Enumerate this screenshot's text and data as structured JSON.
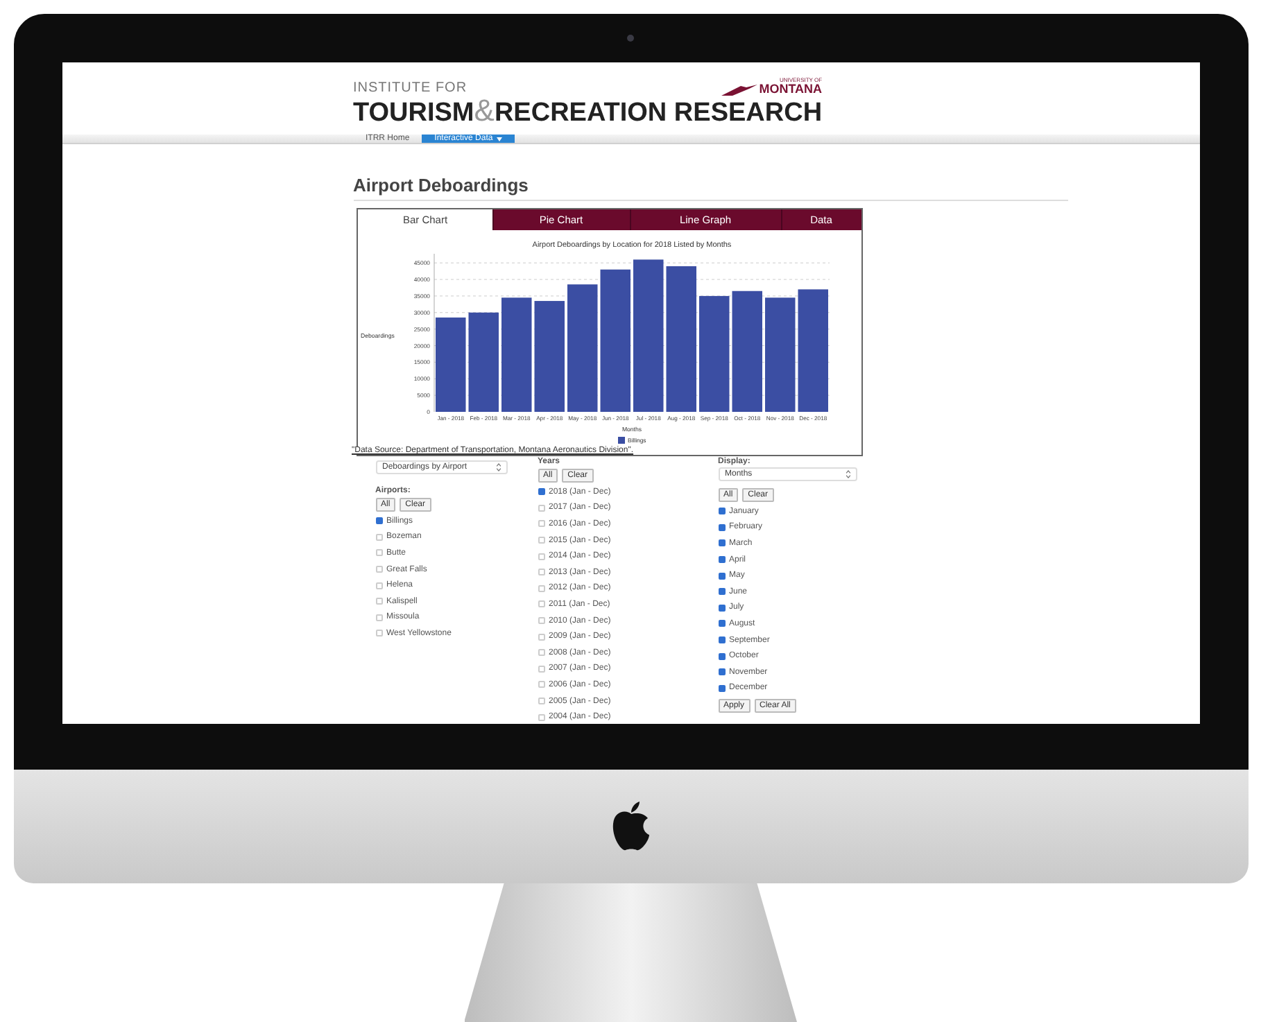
{
  "header": {
    "institute": "INSTITUTE FOR",
    "title_left": "TOURISM",
    "ampersand": "&",
    "title_right": "RECREATION RESEARCH",
    "university": "UNIVERSITY OF",
    "montana": "MONTANA"
  },
  "nav": [
    {
      "label": "ITRR Home",
      "selected": false,
      "dropdown": false
    },
    {
      "label": "Interactive Data",
      "selected": true,
      "dropdown": true
    }
  ],
  "page_title": "Airport Deboardings",
  "tabs": [
    {
      "label": "Bar Chart",
      "selected": true
    },
    {
      "label": "Pie Chart",
      "selected": false
    },
    {
      "label": "Line Graph",
      "selected": false
    },
    {
      "label": "Data",
      "selected": false
    }
  ],
  "chart_data": {
    "type": "bar",
    "title": "Airport Deboardings by Location for 2018 Listed by Months",
    "xlabel": "Months",
    "ylabel": "Deboardings",
    "categories": [
      "Jan - 2018",
      "Feb - 2018",
      "Mar - 2018",
      "Apr - 2018",
      "May - 2018",
      "Jun - 2018",
      "Jul - 2018",
      "Aug - 2018",
      "Sep - 2018",
      "Oct - 2018",
      "Nov - 2018",
      "Dec - 2018"
    ],
    "series": [
      {
        "name": "Billings",
        "color": "#3b4ea3",
        "values": [
          28500,
          30000,
          34500,
          33500,
          38500,
          43000,
          46000,
          44000,
          35000,
          36500,
          34500,
          37000
        ]
      }
    ],
    "ylim": [
      0,
      46500
    ],
    "grid": true,
    "yticks": [
      0,
      5000,
      10000,
      15000,
      20000,
      25000,
      30000,
      35000,
      40000,
      45000
    ]
  },
  "source": "\"Data Source: Department of Transportation, Montana Aeronautics Division\".",
  "metric_select": {
    "value": "Deboardings by Airport"
  },
  "airports": {
    "label": "Airports:",
    "all": "All",
    "clear": "Clear",
    "items": [
      {
        "label": "Billings",
        "checked": true
      },
      {
        "label": "Bozeman",
        "checked": false
      },
      {
        "label": "Butte",
        "checked": false
      },
      {
        "label": "Great Falls",
        "checked": false
      },
      {
        "label": "Helena",
        "checked": false
      },
      {
        "label": "Kalispell",
        "checked": false
      },
      {
        "label": "Missoula",
        "checked": false
      },
      {
        "label": "West Yellowstone",
        "checked": false
      }
    ]
  },
  "years": {
    "label": "Years",
    "all": "All",
    "clear": "Clear",
    "items": [
      {
        "label": "2018 (Jan - Dec)",
        "checked": true
      },
      {
        "label": "2017 (Jan - Dec)",
        "checked": false
      },
      {
        "label": "2016 (Jan - Dec)",
        "checked": false
      },
      {
        "label": "2015 (Jan - Dec)",
        "checked": false
      },
      {
        "label": "2014 (Jan - Dec)",
        "checked": false
      },
      {
        "label": "2013 (Jan - Dec)",
        "checked": false
      },
      {
        "label": "2012 (Jan - Dec)",
        "checked": false
      },
      {
        "label": "2011 (Jan - Dec)",
        "checked": false
      },
      {
        "label": "2010 (Jan - Dec)",
        "checked": false
      },
      {
        "label": "2009 (Jan - Dec)",
        "checked": false
      },
      {
        "label": "2008 (Jan - Dec)",
        "checked": false
      },
      {
        "label": "2007 (Jan - Dec)",
        "checked": false
      },
      {
        "label": "2006 (Jan - Dec)",
        "checked": false
      },
      {
        "label": "2005 (Jan - Dec)",
        "checked": false
      },
      {
        "label": "2004 (Jan - Dec)",
        "checked": false
      }
    ]
  },
  "display": {
    "label": "Display:",
    "value": "Months",
    "all": "All",
    "clear": "Clear",
    "items": [
      {
        "label": "January",
        "checked": true
      },
      {
        "label": "February",
        "checked": true
      },
      {
        "label": "March",
        "checked": true
      },
      {
        "label": "April",
        "checked": true
      },
      {
        "label": "May",
        "checked": true
      },
      {
        "label": "June",
        "checked": true
      },
      {
        "label": "July",
        "checked": true
      },
      {
        "label": "August",
        "checked": true
      },
      {
        "label": "September",
        "checked": true
      },
      {
        "label": "October",
        "checked": true
      },
      {
        "label": "November",
        "checked": true
      },
      {
        "label": "December",
        "checked": true
      }
    ],
    "apply": "Apply",
    "clear_all": "Clear All"
  }
}
